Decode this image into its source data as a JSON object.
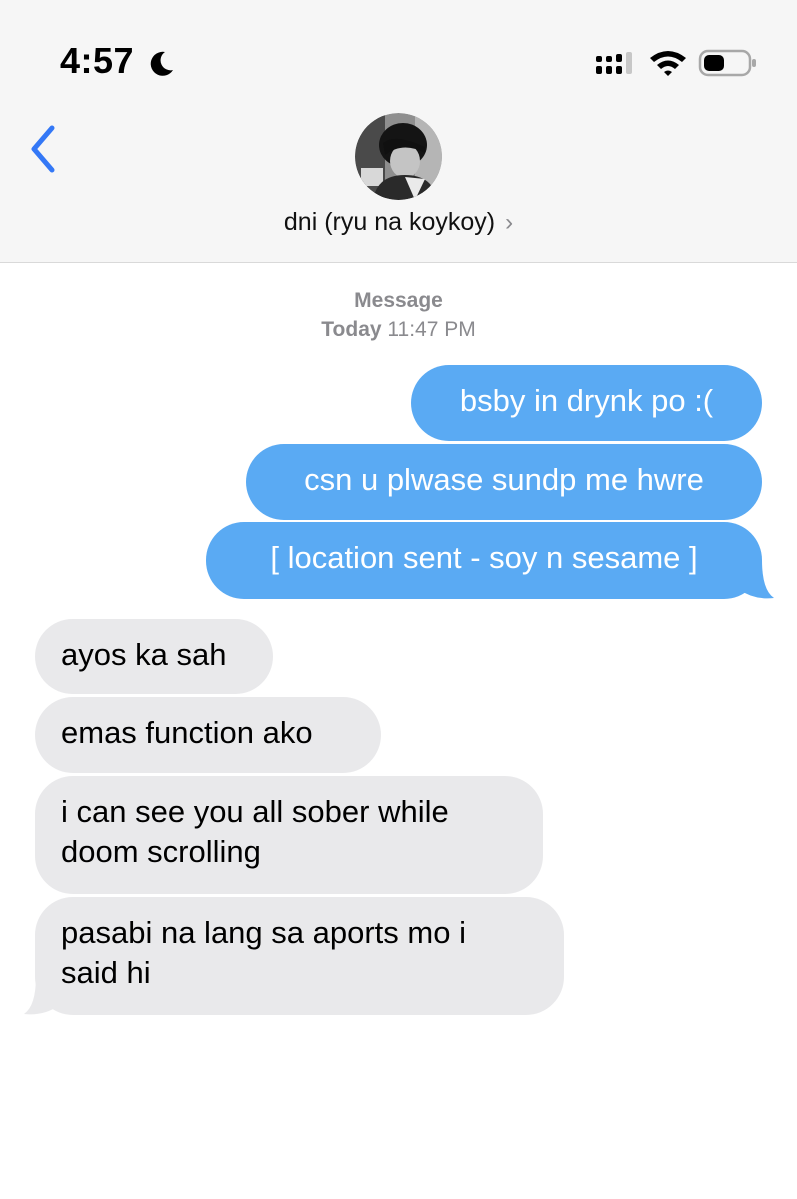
{
  "status_bar": {
    "time": "4:57"
  },
  "header": {
    "contact_name": "dni (ryu na koykoy)",
    "chevron": "›"
  },
  "thread": {
    "service": "Message",
    "day": "Today",
    "time": "11:47 PM"
  },
  "messages": [
    {
      "direction": "outgoing",
      "text": "bsby in drynk po :("
    },
    {
      "direction": "outgoing",
      "text": "csn u plwase sundp me hwre"
    },
    {
      "direction": "outgoing",
      "text": "[ location sent - soy n sesame ]"
    },
    {
      "direction": "incoming",
      "text": "ayos ka sah"
    },
    {
      "direction": "incoming",
      "text": "emas function ako"
    },
    {
      "direction": "incoming",
      "lines": [
        "i can see you all sober while",
        "doom scrolling"
      ]
    },
    {
      "direction": "incoming",
      "lines": [
        "pasabi na lang sa aports mo i",
        "said hi"
      ]
    }
  ],
  "colors": {
    "outgoing": "#5aaaf3",
    "incoming": "#e9e9eb",
    "accent": "#3478f6"
  }
}
